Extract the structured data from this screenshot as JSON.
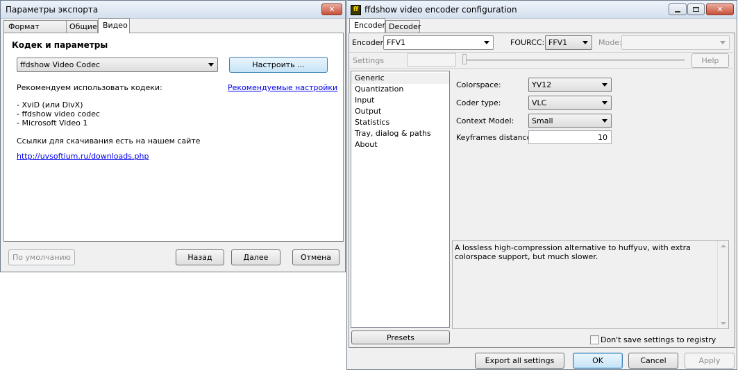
{
  "export_window": {
    "title": "Параметры экспорта",
    "tabs": [
      "Формат файла",
      "Общие",
      "Видео"
    ],
    "active_tab": "Видео",
    "section_title": "Кодек и параметры",
    "codec_select_value": "ffdshow Video Codec",
    "configure_button": "Настроить ...",
    "recommend_text": "Рекомендуем использовать кодеки:",
    "recommended_settings_link": "Рекомендуемые настройки",
    "codecs": [
      "- XviD (или DivX)",
      "- ffdshow video codec",
      "- Microsoft Video 1"
    ],
    "download_text": "Ссылки для скачивания есть на нашем сайте",
    "download_link": "http://uvsoftium.ru/downloads.php",
    "buttons": {
      "default": "По умолчанию",
      "back": "Назад",
      "next": "Далее",
      "cancel": "Отмена"
    }
  },
  "ffdshow_window": {
    "title": "ffdshow video encoder configuration",
    "app_icon_text": "ff",
    "tabs": [
      "Encoder",
      "Decoder"
    ],
    "active_tab": "Encoder",
    "encoder_label": "Encoder:",
    "encoder_value": "FFV1",
    "fourcc_label": "FOURCC:",
    "fourcc_value": "FFV1",
    "mode_label": "Mode:",
    "mode_value": "",
    "settings_label": "Settings",
    "help_button": "Help",
    "nav_items": [
      "Generic",
      "Quantization",
      "Input",
      "Output",
      "Statistics",
      "Tray, dialog & paths",
      "About"
    ],
    "selected_nav": "Generic",
    "fields": {
      "colorspace_label": "Colorspace:",
      "colorspace_value": "YV12",
      "coder_type_label": "Coder type:",
      "coder_type_value": "VLC",
      "context_model_label": "Context Model:",
      "context_model_value": "Small",
      "keyframes_label": "Keyframes distance:",
      "keyframes_value": "10"
    },
    "description": "A lossless high-compression alternative to huffyuv, with extra colorspace support, but much slower.",
    "presets_button": "Presets",
    "dont_save_label": "Don't save settings to registry",
    "dont_save_checked": false,
    "buttons": {
      "export": "Export all settings",
      "ok": "OK",
      "cancel": "Cancel",
      "apply": "Apply"
    }
  }
}
